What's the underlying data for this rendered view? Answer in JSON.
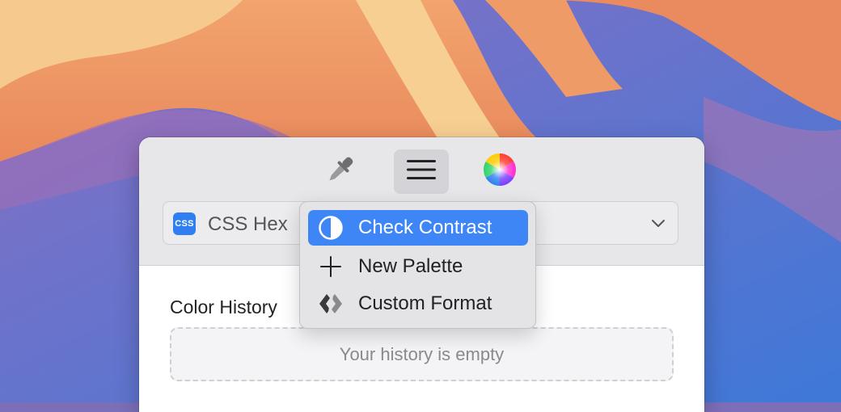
{
  "toolbar": {
    "picker_icon": "eyedropper-icon",
    "menu_icon": "hamburger-menu-icon",
    "wheel_icon": "color-wheel-icon"
  },
  "format": {
    "badge": "CSS",
    "label": "CSS Hex"
  },
  "menu": {
    "items": [
      {
        "label": "Check Contrast",
        "icon": "contrast-icon"
      },
      {
        "label": "New Palette",
        "icon": "plus-icon"
      },
      {
        "label": "Custom Format",
        "icon": "custom-format-icon"
      }
    ]
  },
  "history": {
    "title": "Color History",
    "empty": "Your history is empty"
  },
  "colors": {
    "accent": "#3e86f6",
    "badge": "#2f7ff2"
  }
}
